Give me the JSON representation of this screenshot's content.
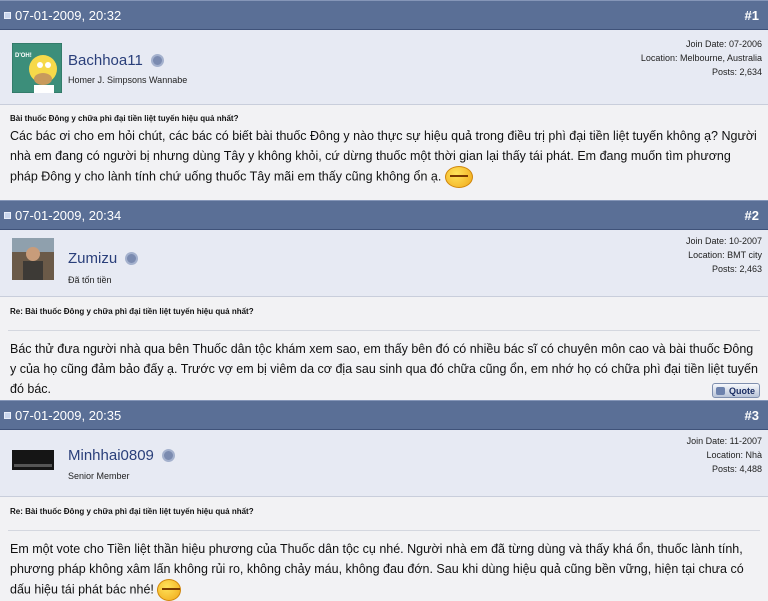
{
  "posts": [
    {
      "date": "07-01-2009, 20:32",
      "number": "#1",
      "username": "Bachhoa11",
      "usertitle": "Homer J. Simpsons Wannabe",
      "join_date": "Join Date: 07-2006",
      "location": "Location: Melbourne, Australia",
      "posts": "Posts: 2,634",
      "title": "Bài thuốc Đông y chữa phì đại tiền liệt tuyến hiệu quả nhất?",
      "message": "Các bác ơi cho em hỏi chút, các bác có biết bài thuốc Đông y nào thực sự hiệu quả trong điều trị phì đại tiền liệt tuyến không ạ? Người nhà em đang có người bị nhưng dùng Tây y không khỏi, cứ dừng thuốc một thời gian lại thấy tái phát. Em đang muốn tìm phương pháp Đông y cho lành tính chứ uống thuốc Tây mãi em thấy cũng không ổn ạ.",
      "avatar_label": "D'OH!"
    },
    {
      "date": "07-01-2009, 20:34",
      "number": "#2",
      "username": "Zumizu",
      "usertitle": "Đã tốn tiền",
      "join_date": "Join Date: 10-2007",
      "location": "Location: BMT city",
      "posts": "Posts: 2,463",
      "title": "Re: Bài thuốc Đông y chữa phì đại tiền liệt tuyến hiệu quả nhất?",
      "message": "Bác thử đưa người nhà qua bên Thuốc dân tộc khám xem sao, em thấy bên đó có nhiều bác sĩ có chuyên môn cao và bài thuốc Đông y của họ cũng đảm bảo đấy ạ. Trước vợ em bị viêm da cơ địa sau sinh qua đó chữa cũng ổn, em nhớ họ có chữa phì đại tiền liệt tuyến đó bác.",
      "quote_label": "Quote"
    },
    {
      "date": "07-01-2009, 20:35",
      "number": "#3",
      "username": "Minhhai0809",
      "usertitle": "Senior Member",
      "join_date": "Join Date: 11-2007",
      "location": "Location: Nhà",
      "posts": "Posts: 4,488",
      "title": "Re: Bài thuốc Đông y chữa phì đại tiền liệt tuyến hiệu quả nhất?",
      "message": "Em một vote cho Tiền liệt thần hiệu phương của Thuốc dân tộc cụ nhé. Người nhà em đã từng dùng và thấy khá ổn, thuốc lành tính, phương pháp không xâm lấn không rủi ro, không chảy máu, không đau đớn. Sau khi dùng hiệu quả cũng bền vững, hiện tại chưa có dấu hiệu tái phát bác nhé!"
    }
  ],
  "colors": {
    "header_bg": "#5a6f96",
    "userinfo_bg": "#e7eaf3",
    "body_bg": "#f2f2f4",
    "username": "#2a3f7a"
  }
}
